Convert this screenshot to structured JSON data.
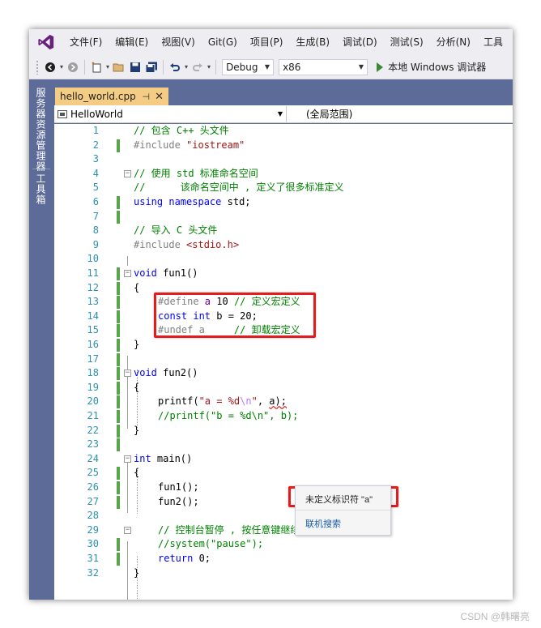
{
  "menu": [
    "文件(F)",
    "编辑(E)",
    "视图(V)",
    "Git(G)",
    "项目(P)",
    "生成(B)",
    "调试(D)",
    "测试(S)",
    "分析(N)",
    "工具"
  ],
  "toolbar": {
    "config": "Debug",
    "platform": "x86",
    "run_label": "本地 Windows 调试器"
  },
  "side_tabs": [
    "服务器资源管理器",
    "工具箱"
  ],
  "doc_tab": {
    "name": "hello_world.cpp",
    "pin": "⊣",
    "close": "✕"
  },
  "navbar": {
    "scope_left": "HelloWorld",
    "scope_right": "(全局范围)"
  },
  "line_numbers": [
    "1",
    "2",
    "3",
    "4",
    "5",
    "6",
    "7",
    "8",
    "9",
    "10",
    "11",
    "12",
    "13",
    "14",
    "15",
    "16",
    "17",
    "18",
    "19",
    "20",
    "21",
    "22",
    "23",
    "24",
    "25",
    "26",
    "27",
    "28",
    "29",
    "30",
    "31",
    "32"
  ],
  "code": {
    "l1": "// 包含 C++ 头文件",
    "l2_pp": "#include ",
    "l2_str": "\"iostream\"",
    "l4": "// 使用 std 标准命名空间",
    "l5": "//      该命名空间中 , 定义了很多标准定义",
    "l6_kw1": "using",
    "l6_kw2": "namespace",
    "l6_rest": " std;",
    "l8": "// 导入 C 头文件",
    "l9_pp": "#include ",
    "l9_str": "<stdio.h>",
    "l11_kw": "void",
    "l11_rest": " fun1()",
    "l12": "{",
    "l13_pp": "#define ",
    "l13_mac": "a",
    "l13_rest": " 10 ",
    "l13_com": "// 定义宏定义",
    "l14_kw1": "const",
    "l14_kw2": "int",
    "l14_rest": " b = 20;",
    "l15_pp": "#undef a     ",
    "l15_com": "// 卸载宏定义",
    "l16": "}",
    "l18_kw": "void",
    "l18_rest": " fun2()",
    "l19": "{",
    "l20_a": "printf(",
    "l20_s1": "\"a = %d",
    "l20_esc": "\\n",
    "l20_s2": "\"",
    "l20_b": ", ",
    "l20_c": "a);",
    "l21_com": "//printf(\"b = %d\\n\", b);",
    "l22": "}",
    "l24_kw": "int",
    "l24_rest": " main()",
    "l25": "{",
    "l26": "fun1();",
    "l27": "fun2();",
    "l29_com": "// 控制台暂停 , 按任意键继续向后执行",
    "l30_com": "//system(\"pause\");",
    "l31_kw": "return",
    "l31_rest": " 0;",
    "l32": "}"
  },
  "popup": {
    "title": "未定义标识符 \"a\"",
    "link": "联机搜索"
  },
  "watermark": "CSDN @韩曙亮",
  "colors": {
    "accent": "#68217a",
    "chrome": "#eeeef2",
    "sidebar": "#5d6b99",
    "tab_active": "#f5cc84",
    "change_bar": "#57a64a",
    "highlight": "#e51c1c"
  }
}
